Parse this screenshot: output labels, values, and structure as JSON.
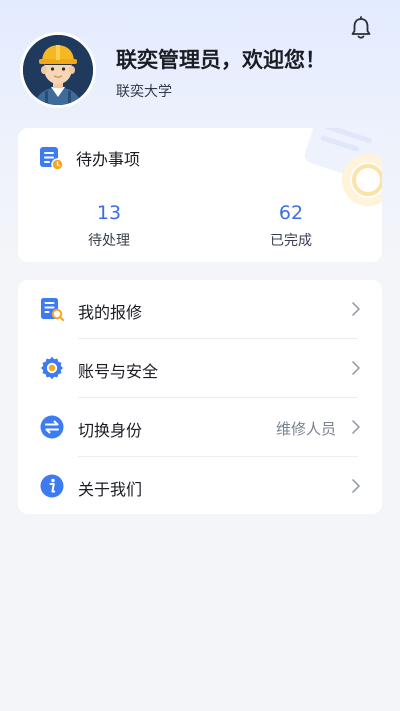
{
  "header": {
    "greeting": "联奕管理员，欢迎您！",
    "school": "联奕大学",
    "notification_icon": "bell-icon"
  },
  "todo": {
    "title": "待办事项",
    "pending": {
      "count": "13",
      "label": "待处理"
    },
    "done": {
      "count": "62",
      "label": "已完成"
    }
  },
  "menu": [
    {
      "label": "我的报修",
      "icon": "repair-doc-icon",
      "value": ""
    },
    {
      "label": "账号与安全",
      "icon": "gear-icon",
      "value": ""
    },
    {
      "label": "切换身份",
      "icon": "switch-icon",
      "value": "维修人员"
    },
    {
      "label": "关于我们",
      "icon": "info-icon",
      "value": ""
    }
  ],
  "colors": {
    "accent": "#3a6ee8",
    "icon_blue": "#3d7bf0",
    "icon_orange": "#f5a623"
  }
}
